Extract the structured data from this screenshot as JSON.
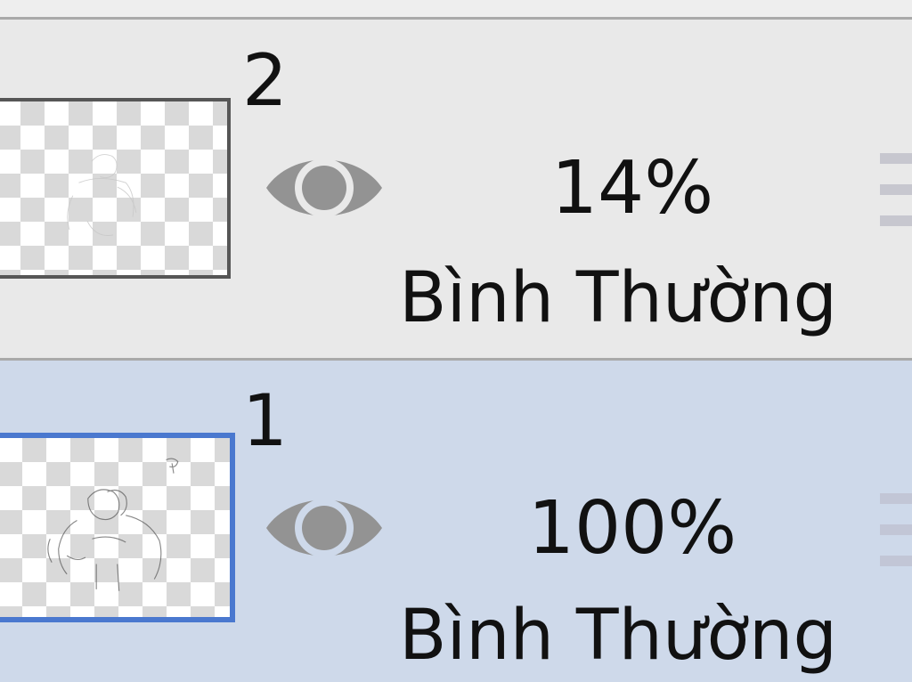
{
  "layers": [
    {
      "number": "2",
      "visibility_icon": "eye-icon",
      "opacity": "14%",
      "blend_mode": "Bình Thường",
      "selected": false
    },
    {
      "number": "1",
      "visibility_icon": "eye-icon",
      "opacity": "100%",
      "blend_mode": "Bình Thường",
      "selected": true
    }
  ],
  "colors": {
    "panel_background": "#e9e9e9",
    "selected_row_background": "#ced9ea",
    "selected_thumbnail_border": "#4a78cf",
    "eye_icon": "#939393",
    "separator": "#a9a9a9"
  }
}
